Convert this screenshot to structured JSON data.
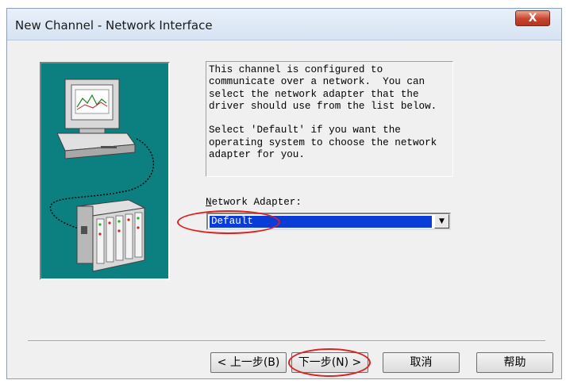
{
  "window": {
    "title": "New Channel - Network Interface",
    "close_glyph": "X"
  },
  "illustration": {
    "background_color": "#0c8080",
    "icons": [
      "computer-monitor-icon",
      "network-device-icon"
    ]
  },
  "description": {
    "text": "This channel is configured to\ncommunicate over a network.  You can\nselect the network adapter that the\ndriver should use from the list below.\n\nSelect 'Default' if you want the\noperating system to choose the network\nadapter for you."
  },
  "network_adapter": {
    "label_mnemonic": "N",
    "label_rest": "etwork Adapter:",
    "selected": "Default",
    "dropdown_glyph": "▼"
  },
  "buttons": {
    "back": "< 上一步(B)",
    "next": "下一步(N) >",
    "cancel": "取消",
    "help": "帮助"
  },
  "annotations": {
    "highlight_color": "#dc2020"
  }
}
